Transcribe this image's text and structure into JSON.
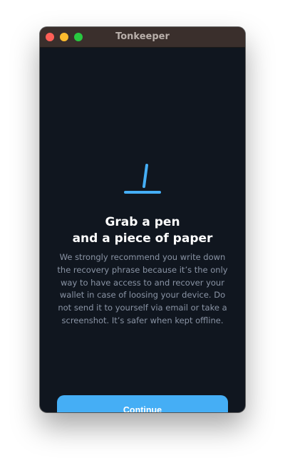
{
  "window": {
    "title": "Tonkeeper"
  },
  "illustration": {
    "icon": "pen-icon",
    "color": "#45AEF5"
  },
  "main": {
    "heading_line1": "Grab a pen",
    "heading_line2": "and a piece of paper",
    "body": "We strongly recommend you write down the recovery phrase because it’s the only way to have access to and recover your wallet in case of loosing your device. Do not send it to yourself via email or take a screenshot. It’s safer when kept offline."
  },
  "actions": {
    "continue_label": "Continue"
  },
  "colors": {
    "accent": "#45AEF5",
    "background": "#10161F",
    "secondary_text": "#8A94A5"
  }
}
